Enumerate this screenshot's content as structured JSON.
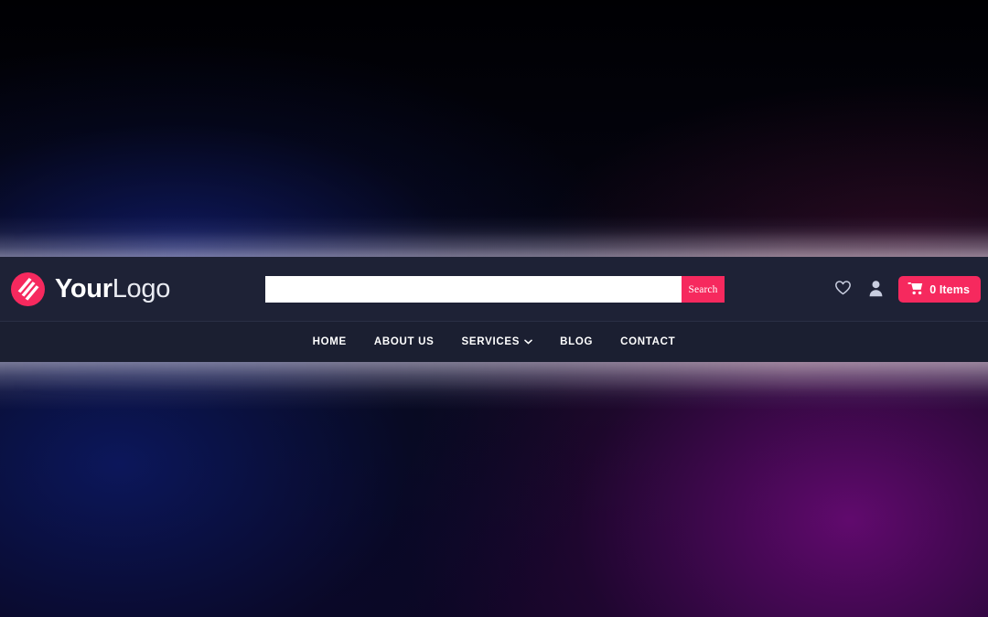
{
  "brand": {
    "logo_icon": "logo-slash-circle-icon",
    "name_bold": "Your",
    "name_light": "Logo"
  },
  "search": {
    "value": "",
    "placeholder": "",
    "button_label": "Search"
  },
  "header_actions": {
    "wishlist_icon": "heart-icon",
    "account_icon": "user-icon",
    "cart_icon": "shopping-cart-icon",
    "cart_label": "0 Items"
  },
  "nav": {
    "items": [
      {
        "label": "HOME",
        "has_dropdown": false
      },
      {
        "label": "ABOUT US",
        "has_dropdown": false
      },
      {
        "label": "SERVICES",
        "has_dropdown": true
      },
      {
        "label": "BLOG",
        "has_dropdown": false
      },
      {
        "label": "CONTACT",
        "has_dropdown": false
      }
    ]
  },
  "colors": {
    "accent_pink": "#f6295e",
    "header_bg": "#1e2236",
    "nav_bg": "#1b1f31",
    "text_white": "#ffffff"
  }
}
